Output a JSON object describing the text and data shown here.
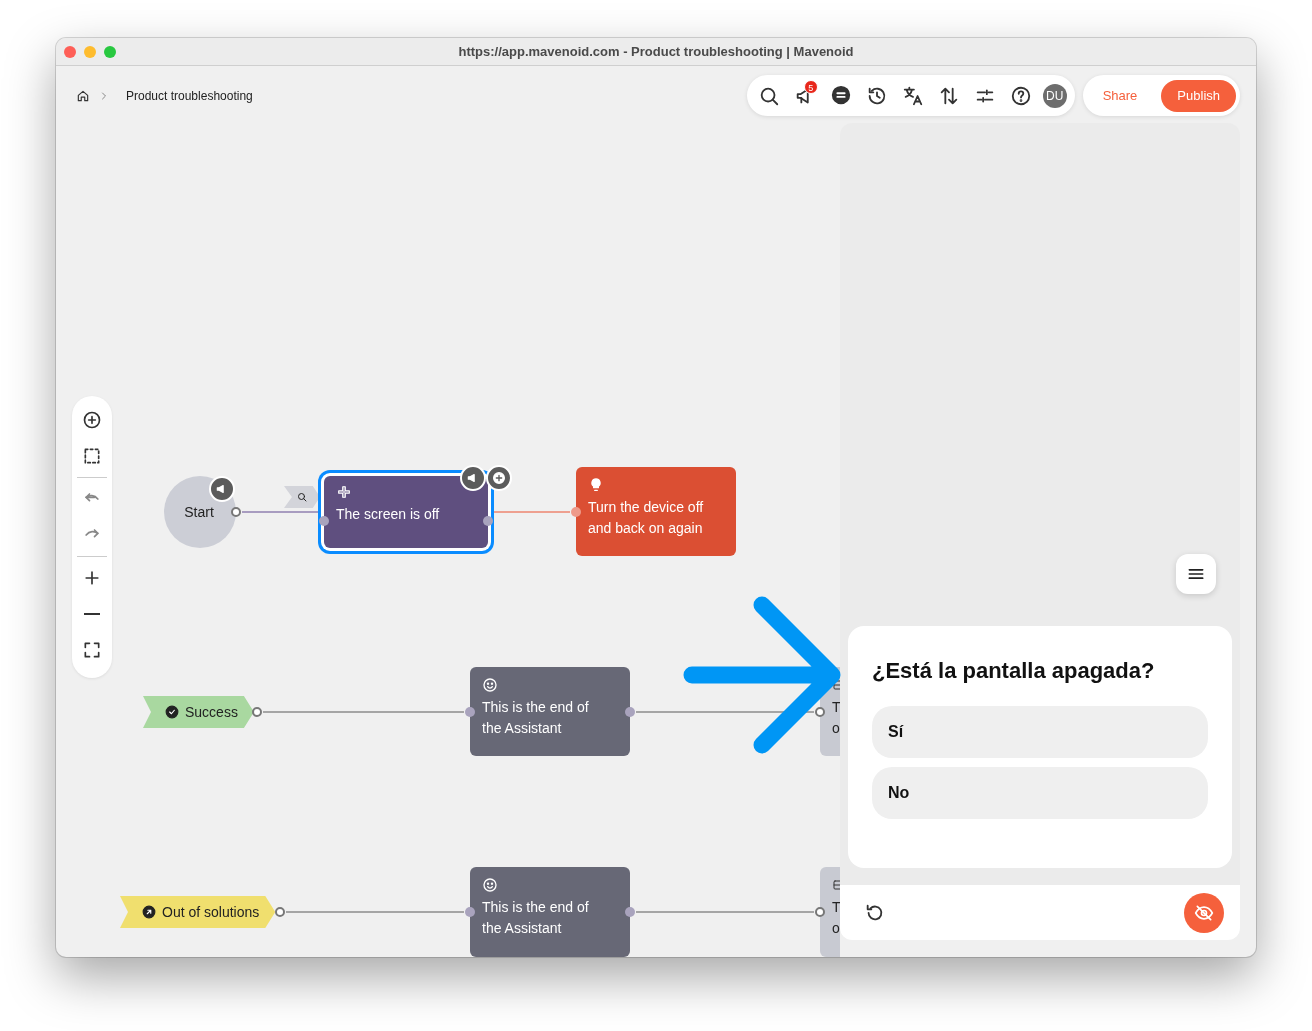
{
  "window": {
    "title": "https://app.mavenoid.com - Product troubleshooting | Mavenoid"
  },
  "breadcrumb": {
    "items": [
      "Product troubleshooting"
    ]
  },
  "toolbar": {
    "notification_count": "5",
    "avatar": "DU"
  },
  "actions": [
    {
      "label": "Share",
      "kind": "secondary"
    },
    {
      "label": "Publish",
      "kind": "primary"
    }
  ],
  "canvas": {
    "nodes": [
      {
        "kind": "start",
        "text": "Start"
      },
      {
        "kind": "question",
        "text": "The screen is off",
        "selected": true
      },
      {
        "kind": "solution",
        "text": "Turn the device off\nand back on again"
      },
      {
        "kind": "tag",
        "text": "Success",
        "color": "#a9d8a0"
      },
      {
        "kind": "end",
        "text": "This is the end of\nthe Assistant"
      },
      {
        "kind": "partial",
        "text": "T\no"
      },
      {
        "kind": "tag",
        "text": "Out of solutions",
        "color": "#f0df6e"
      },
      {
        "kind": "end",
        "text": "This is the end of\nthe Assistant"
      },
      {
        "kind": "partial",
        "text": "T\no"
      }
    ]
  },
  "preview": {
    "question": "¿Está la pantalla apagada?",
    "options": [
      "Sí",
      "No"
    ]
  }
}
